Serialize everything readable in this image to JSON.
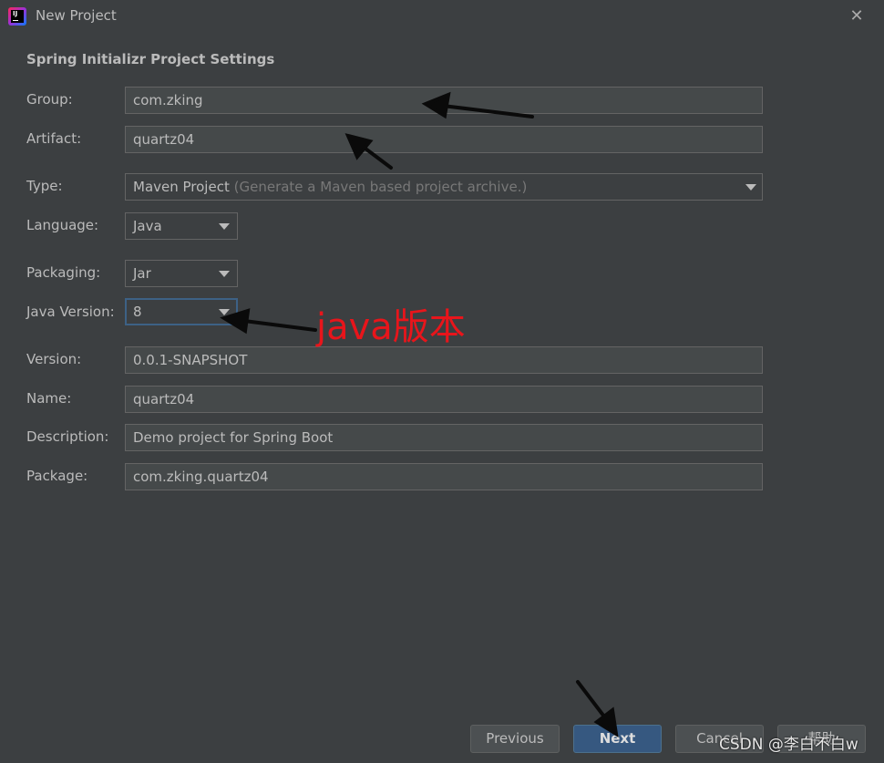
{
  "window": {
    "title": "New Project",
    "app_icon_text": "IJ"
  },
  "section_title": "Spring Initializr Project Settings",
  "fields": {
    "group": {
      "label": "Group:",
      "value": "com.zking"
    },
    "artifact": {
      "label": "Artifact:",
      "value": "quartz04"
    },
    "type": {
      "label": "Type:",
      "value": "Maven Project",
      "hint": "(Generate a Maven based project archive.)"
    },
    "language": {
      "label": "Language:",
      "value": "Java"
    },
    "packaging": {
      "label": "Packaging:",
      "value": "Jar"
    },
    "java_version": {
      "label": "Java Version:",
      "value": "8"
    },
    "version": {
      "label": "Version:",
      "value": "0.0.1-SNAPSHOT"
    },
    "name": {
      "label": "Name:",
      "value": "quartz04"
    },
    "description": {
      "label": "Description:",
      "value": "Demo project for Spring Boot"
    },
    "package": {
      "label": "Package:",
      "value": "com.zking.quartz04"
    }
  },
  "buttons": {
    "previous": "Previous",
    "next": "Next",
    "cancel": "Cancel",
    "help": "帮助"
  },
  "annotation": {
    "text": "java版本",
    "color": "#e8151b"
  },
  "watermark": "CSDN @李白不白w",
  "colors": {
    "background": "#3c3f41",
    "field_background": "#45494a",
    "primary_button": "#365880",
    "focus_border": "#3d6185"
  }
}
